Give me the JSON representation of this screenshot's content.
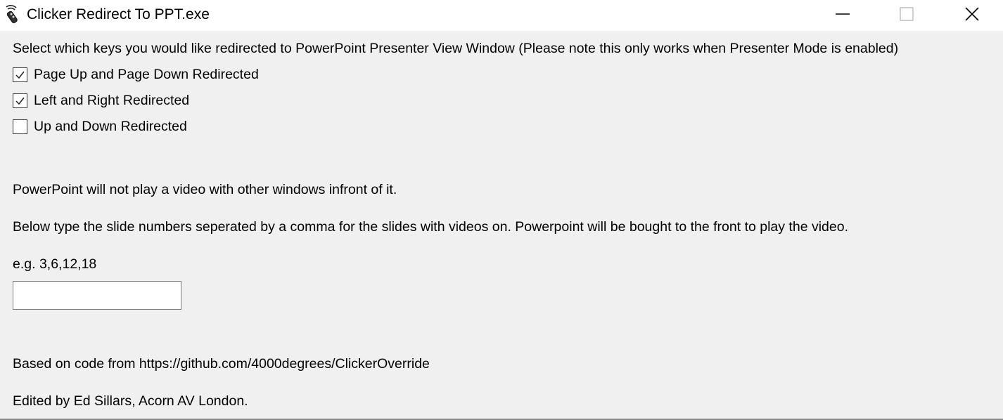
{
  "window": {
    "title": "Clicker Redirect To PPT.exe",
    "controls": {
      "minimize_icon": "minimize-icon",
      "maximize_icon": "maximize-icon",
      "close_icon": "close-icon"
    }
  },
  "main": {
    "instructions": "Select which keys you would like redirected to PowerPoint Presenter View Window (Please note this only works when Presenter Mode is enabled)",
    "options": [
      {
        "label": "Page Up and Page Down Redirected",
        "checked": true
      },
      {
        "label": "Left and Right Redirected",
        "checked": true
      },
      {
        "label": "Up and Down Redirected",
        "checked": false
      }
    ],
    "video_note": "PowerPoint will not play a video with other windows infront of it.",
    "video_instructions": "Below type the slide numbers seperated by a comma for the slides with videos on. Powerpoint will be bought to the front to play the video.",
    "example": "e.g. 3,6,12,18",
    "slide_numbers_input": {
      "value": "",
      "placeholder": ""
    },
    "credits": {
      "based_on": "Based on code from https://github.com/4000degrees/ClickerOverride",
      "edited_by": "Edited by Ed Sillars, Acorn AV London."
    }
  },
  "colors": {
    "titlebar_bg": "#ffffff",
    "window_bg": "#f0f0f0",
    "text": "#000000"
  }
}
